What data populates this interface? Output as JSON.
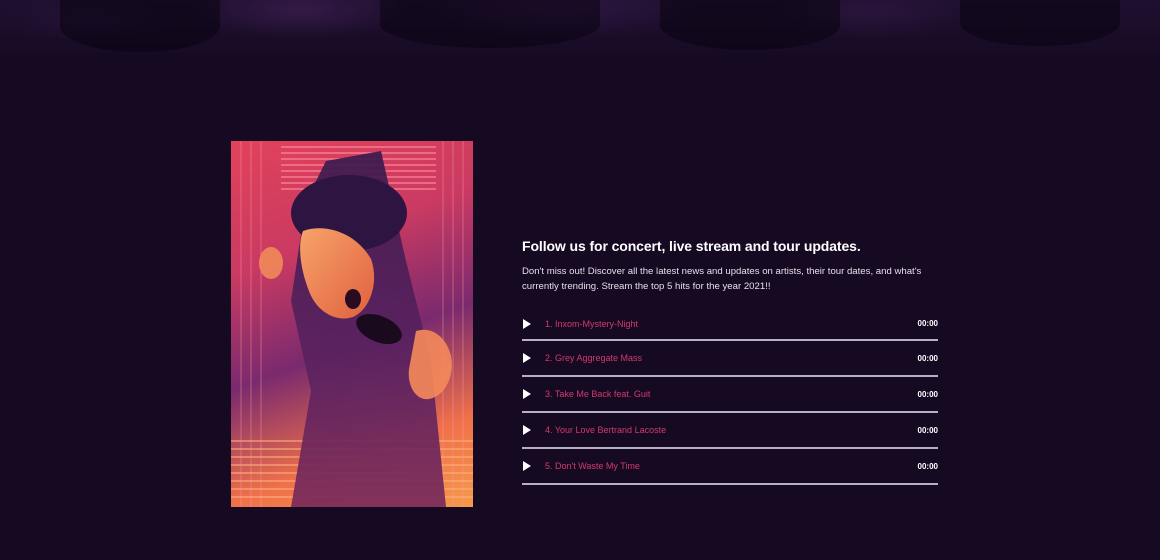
{
  "section": {
    "heading": "Follow us for concert, live stream and tour updates.",
    "description": "Don't miss out! Discover all the latest news and updates on artists, their tour dates, and what's currently trending. Stream the top 5 hits for the year 2021!!"
  },
  "playlist": {
    "tracks": [
      {
        "title": "1. Inxom-Mystery-Night",
        "duration": "00:00"
      },
      {
        "title": "2. Grey Aggregate Mass",
        "duration": "00:00"
      },
      {
        "title": "3. Take Me Back feat. Guit",
        "duration": "00:00"
      },
      {
        "title": "4. Your Love Bertrand Lacoste",
        "duration": "00:00"
      },
      {
        "title": "5. Don't Waste My Time",
        "duration": "00:00"
      }
    ]
  },
  "colors": {
    "background": "#160a22",
    "track_title": "#d23a6e",
    "divider": "#b8b0c0"
  },
  "icons": {
    "play": "play-icon"
  }
}
